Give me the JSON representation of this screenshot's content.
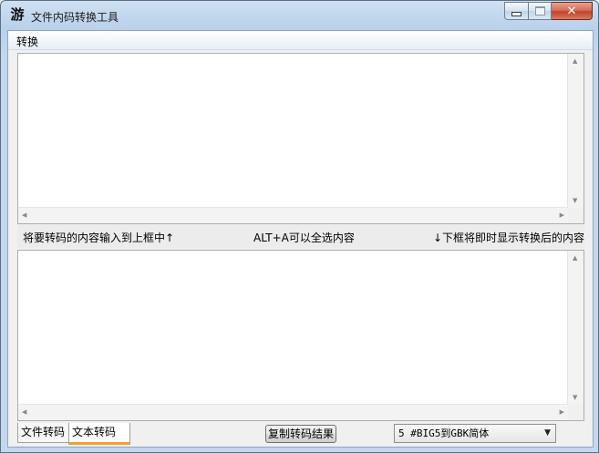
{
  "window": {
    "title": "文件内码转换工具",
    "app_icon": "游"
  },
  "caption": {
    "close_glyph": "✕"
  },
  "menu": {
    "items": [
      "转换"
    ]
  },
  "hints": {
    "left": "将要转码的内容输入到上框中↑",
    "center": "ALT+A可以全选内容",
    "right": "↓下框将即时显示转换后的内容"
  },
  "editors": {
    "top_value": "",
    "bottom_value": ""
  },
  "tabs": [
    {
      "label": "文件转码",
      "selected": false
    },
    {
      "label": "文本转码",
      "selected": true
    }
  ],
  "buttons": {
    "copy_result": "复制转码结果"
  },
  "conversion_select": {
    "selected": "5 #BIG5到GBK简体"
  },
  "colors": {
    "tab_accent": "#f0a030",
    "close_button": "#c2432b"
  }
}
